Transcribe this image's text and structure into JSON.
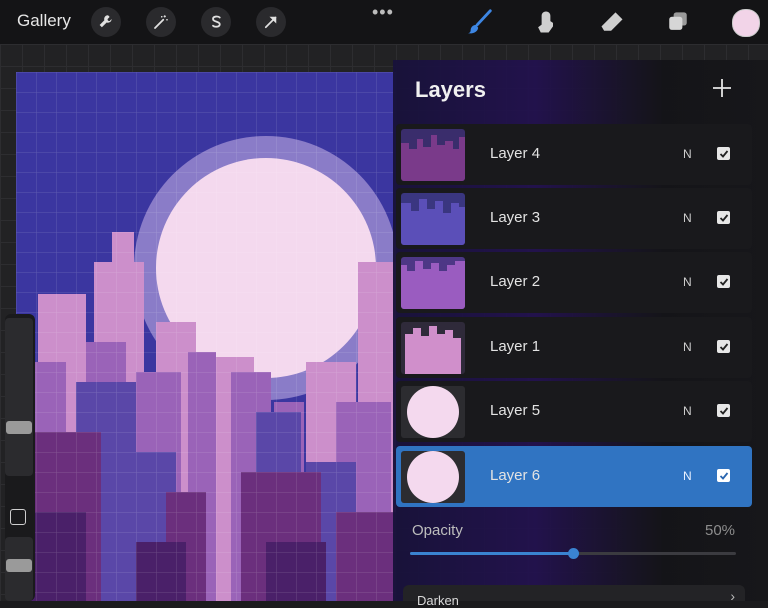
{
  "topbar": {
    "gallery_label": "Gallery",
    "tools": [
      "wrench-icon",
      "magic-wand-icon",
      "selection-s-icon",
      "transform-arrow-icon"
    ],
    "more": "•••",
    "right_tools": [
      "brush-icon",
      "smudge-icon",
      "eraser-icon",
      "layers-icon"
    ],
    "current_color": "#f2d4e8"
  },
  "layers_panel": {
    "title": "Layers",
    "add_icon": "plus-icon",
    "layers": [
      {
        "name": "Layer 4",
        "blend": "N",
        "visible": true,
        "active": false
      },
      {
        "name": "Layer 3",
        "blend": "N",
        "visible": true,
        "active": false
      },
      {
        "name": "Layer 2",
        "blend": "N",
        "visible": true,
        "active": false
      },
      {
        "name": "Layer 1",
        "blend": "N",
        "visible": true,
        "active": false
      },
      {
        "name": "Layer 5",
        "blend": "N",
        "visible": true,
        "active": false
      },
      {
        "name": "Layer 6",
        "blend": "N",
        "visible": true,
        "active": true
      }
    ],
    "opacity_label": "Opacity",
    "opacity_value": "50%",
    "opacity_fraction": 0.5,
    "blend_mode_label": "Darken"
  },
  "colors": {
    "accent": "#3074c2",
    "sky": "#3b36a0",
    "moon": "#f4d9ee"
  }
}
